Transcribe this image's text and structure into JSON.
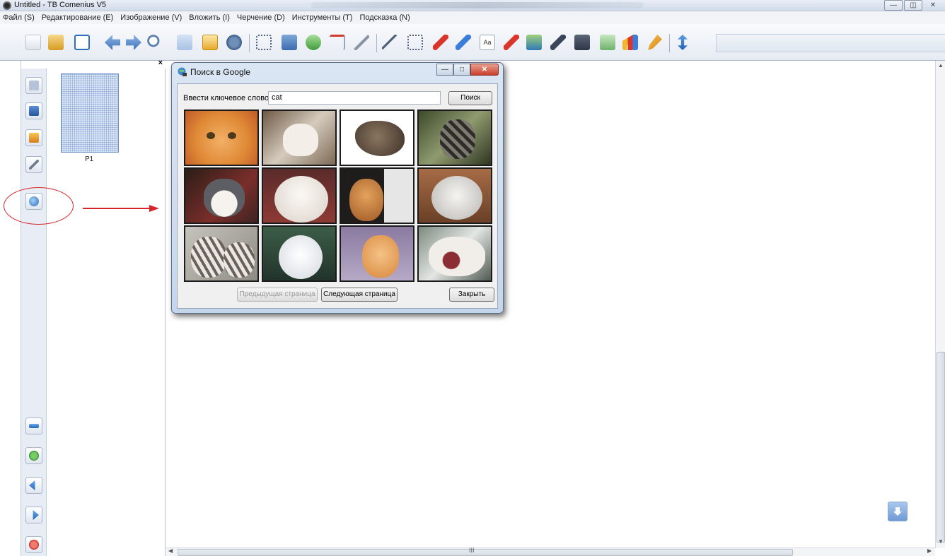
{
  "window": {
    "title": "Untitled - TB Comenius V5"
  },
  "menu": [
    "Файл (S)",
    "Редактирование (E)",
    "Изображение (V)",
    "Вложить (I)",
    "Черчение (D)",
    "Инструменты (T)",
    "Подсказка (N)"
  ],
  "left_panel": {
    "close": "×",
    "page_label": "P1"
  },
  "dialog": {
    "title": "Поиск в Google",
    "keyword_label": "Ввести ключевое слово",
    "keyword_value": "cat",
    "search_label": "Поиск",
    "prev_label": "Предыдущая страница",
    "next_label": "Следующая страница",
    "close_label": "Закрыть"
  },
  "annotation": {
    "color": "#d6262a"
  }
}
